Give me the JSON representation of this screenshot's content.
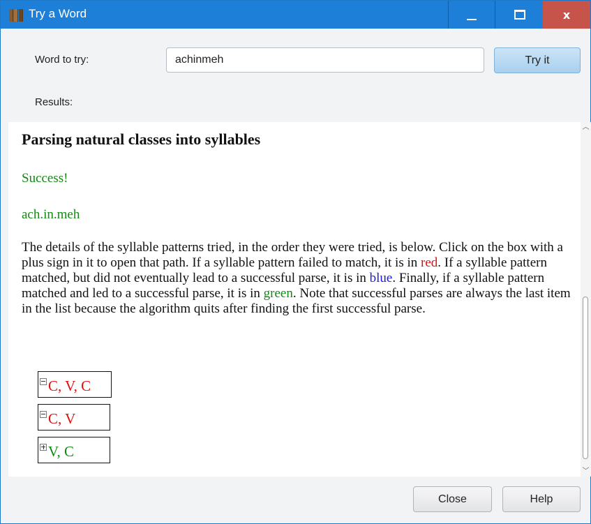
{
  "window": {
    "title": "Try a Word",
    "close_glyph": "x"
  },
  "form": {
    "word_label": "Word to try:",
    "word_value": "achinmeh",
    "try_button": "Try it",
    "results_label": "Results:"
  },
  "results": {
    "heading": "Parsing natural classes into syllables",
    "status": "Success!",
    "parse": "ach.in.meh",
    "description": {
      "part1": "The details of the syllable patterns tried, in the order they were tried, is below. Click on the box with a plus sign in it to open that path. If a syllable pattern failed to match, it is in ",
      "red_word": "red",
      "part2": ". If a syllable pattern matched, but did not eventually lead to a successful parse, it is in ",
      "blue_word": "blue",
      "part3": ". Finally, if a syllable pattern matched and led to a successful parse, it is in ",
      "green_word": "green",
      "part4": ". Note that successful parses are always the last item in the list because the algorithm quits after finding the first successful parse."
    },
    "tree": [
      {
        "label": "C, V, C",
        "state": "expanded",
        "status_color": "#e01010"
      },
      {
        "label": "C, V",
        "state": "expanded",
        "status_color": "#e01010"
      },
      {
        "label": "V, C",
        "state": "collapsed",
        "status_color": "#138a13"
      }
    ]
  },
  "footer": {
    "close_button": "Close",
    "help_button": "Help"
  },
  "colors": {
    "titlebar": "#1e7fd8",
    "close_hover": "#c7544a",
    "success_green": "#138a13",
    "fail_red": "#e01010",
    "partial_blue": "#1a1ae8"
  }
}
